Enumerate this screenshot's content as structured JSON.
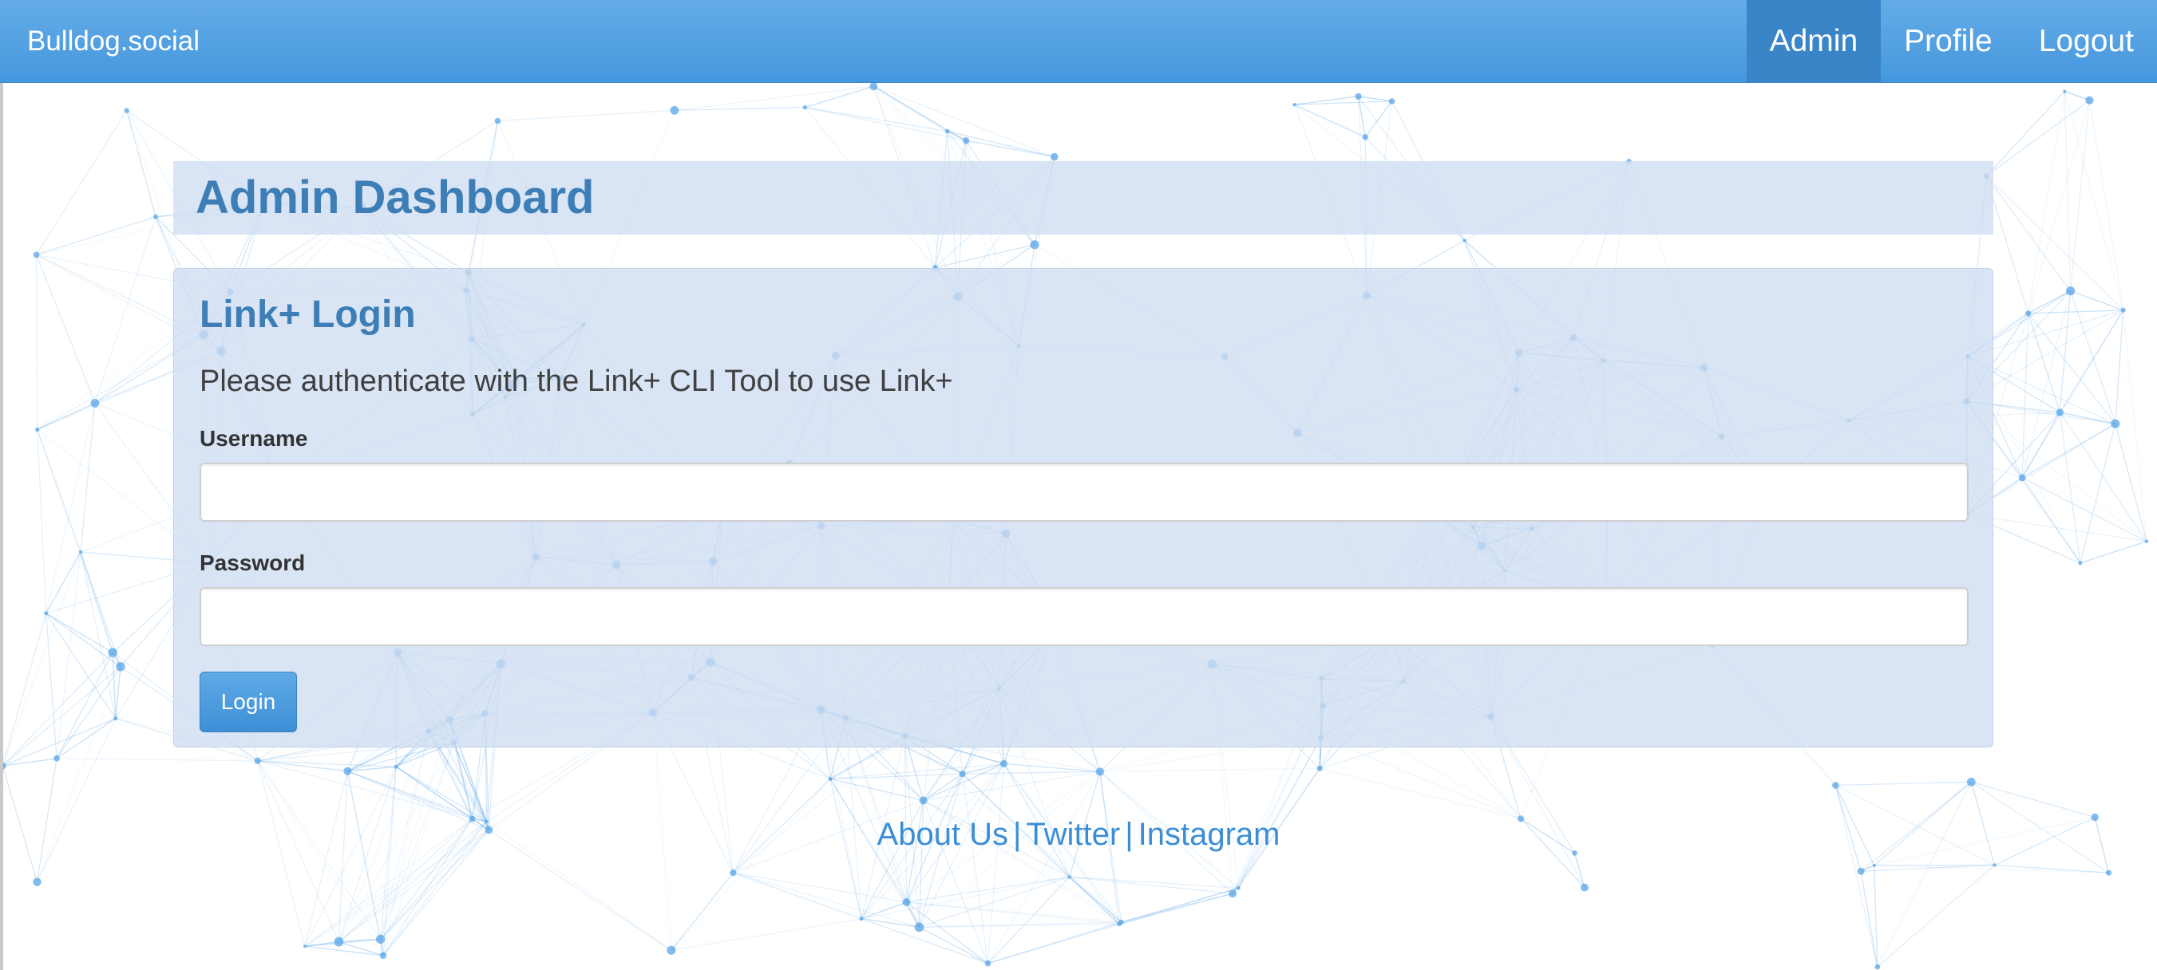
{
  "navbar": {
    "brand": "Bulldog.social",
    "items": [
      {
        "label": "Admin",
        "active": true
      },
      {
        "label": "Profile",
        "active": false
      },
      {
        "label": "Logout",
        "active": false
      }
    ]
  },
  "header": {
    "title": "Admin Dashboard"
  },
  "login_panel": {
    "title": "Link+ Login",
    "description": "Please authenticate with the Link+ CLI Tool to use Link+",
    "username_label": "Username",
    "username_value": "",
    "password_label": "Password",
    "password_value": "",
    "button_label": "Login"
  },
  "footer": {
    "links": [
      "About Us",
      "Twitter",
      "Instagram"
    ],
    "separator": "|"
  },
  "colors": {
    "navbar": "#4597dd",
    "nav_active": "#3a84c8",
    "panel": "#cedcf1",
    "heading": "#3d7eb6",
    "link": "#3b8ed5",
    "network": "#5aa5e6"
  }
}
